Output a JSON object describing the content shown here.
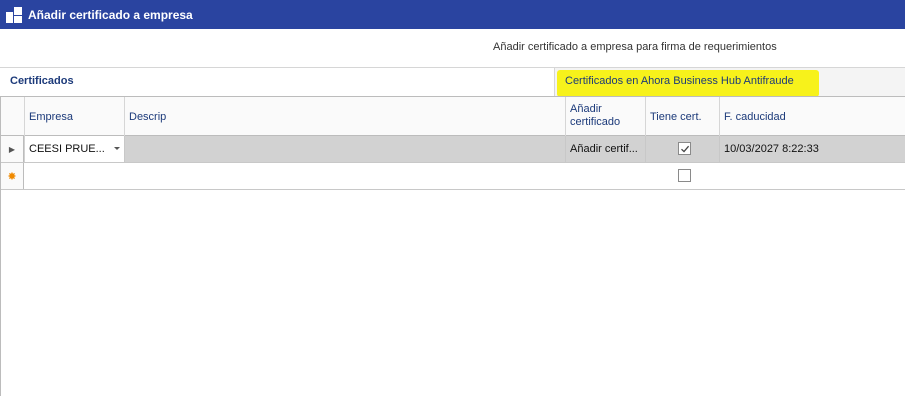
{
  "window": {
    "title": "Añadir certificado a empresa"
  },
  "subtitle": "Añadir certificado a empresa para firma de requerimientos",
  "section": {
    "title": "Certificados",
    "tab_label": "Certificados en Ahora Business Hub Antifraude"
  },
  "grid": {
    "columns": {
      "empresa": "Empresa",
      "descrip": "Descrip",
      "anadir_line1": "Añadir",
      "anadir_line2": "certificado",
      "tiene": "Tiene cert.",
      "caducidad": "F. caducidad"
    },
    "rows": [
      {
        "empresa": "CEESI PRUE...",
        "descrip": "",
        "anadir": "Añadir certif...",
        "tiene_cert": true,
        "caducidad": "10/03/2027 8:22:33"
      }
    ],
    "new_row": {
      "tiene_cert": false,
      "marker": "✸"
    },
    "row_selector": "▶"
  },
  "colors": {
    "titlebar": "#2a44a0",
    "highlight": "#f7f21b",
    "header_text": "#1c3a7a"
  }
}
